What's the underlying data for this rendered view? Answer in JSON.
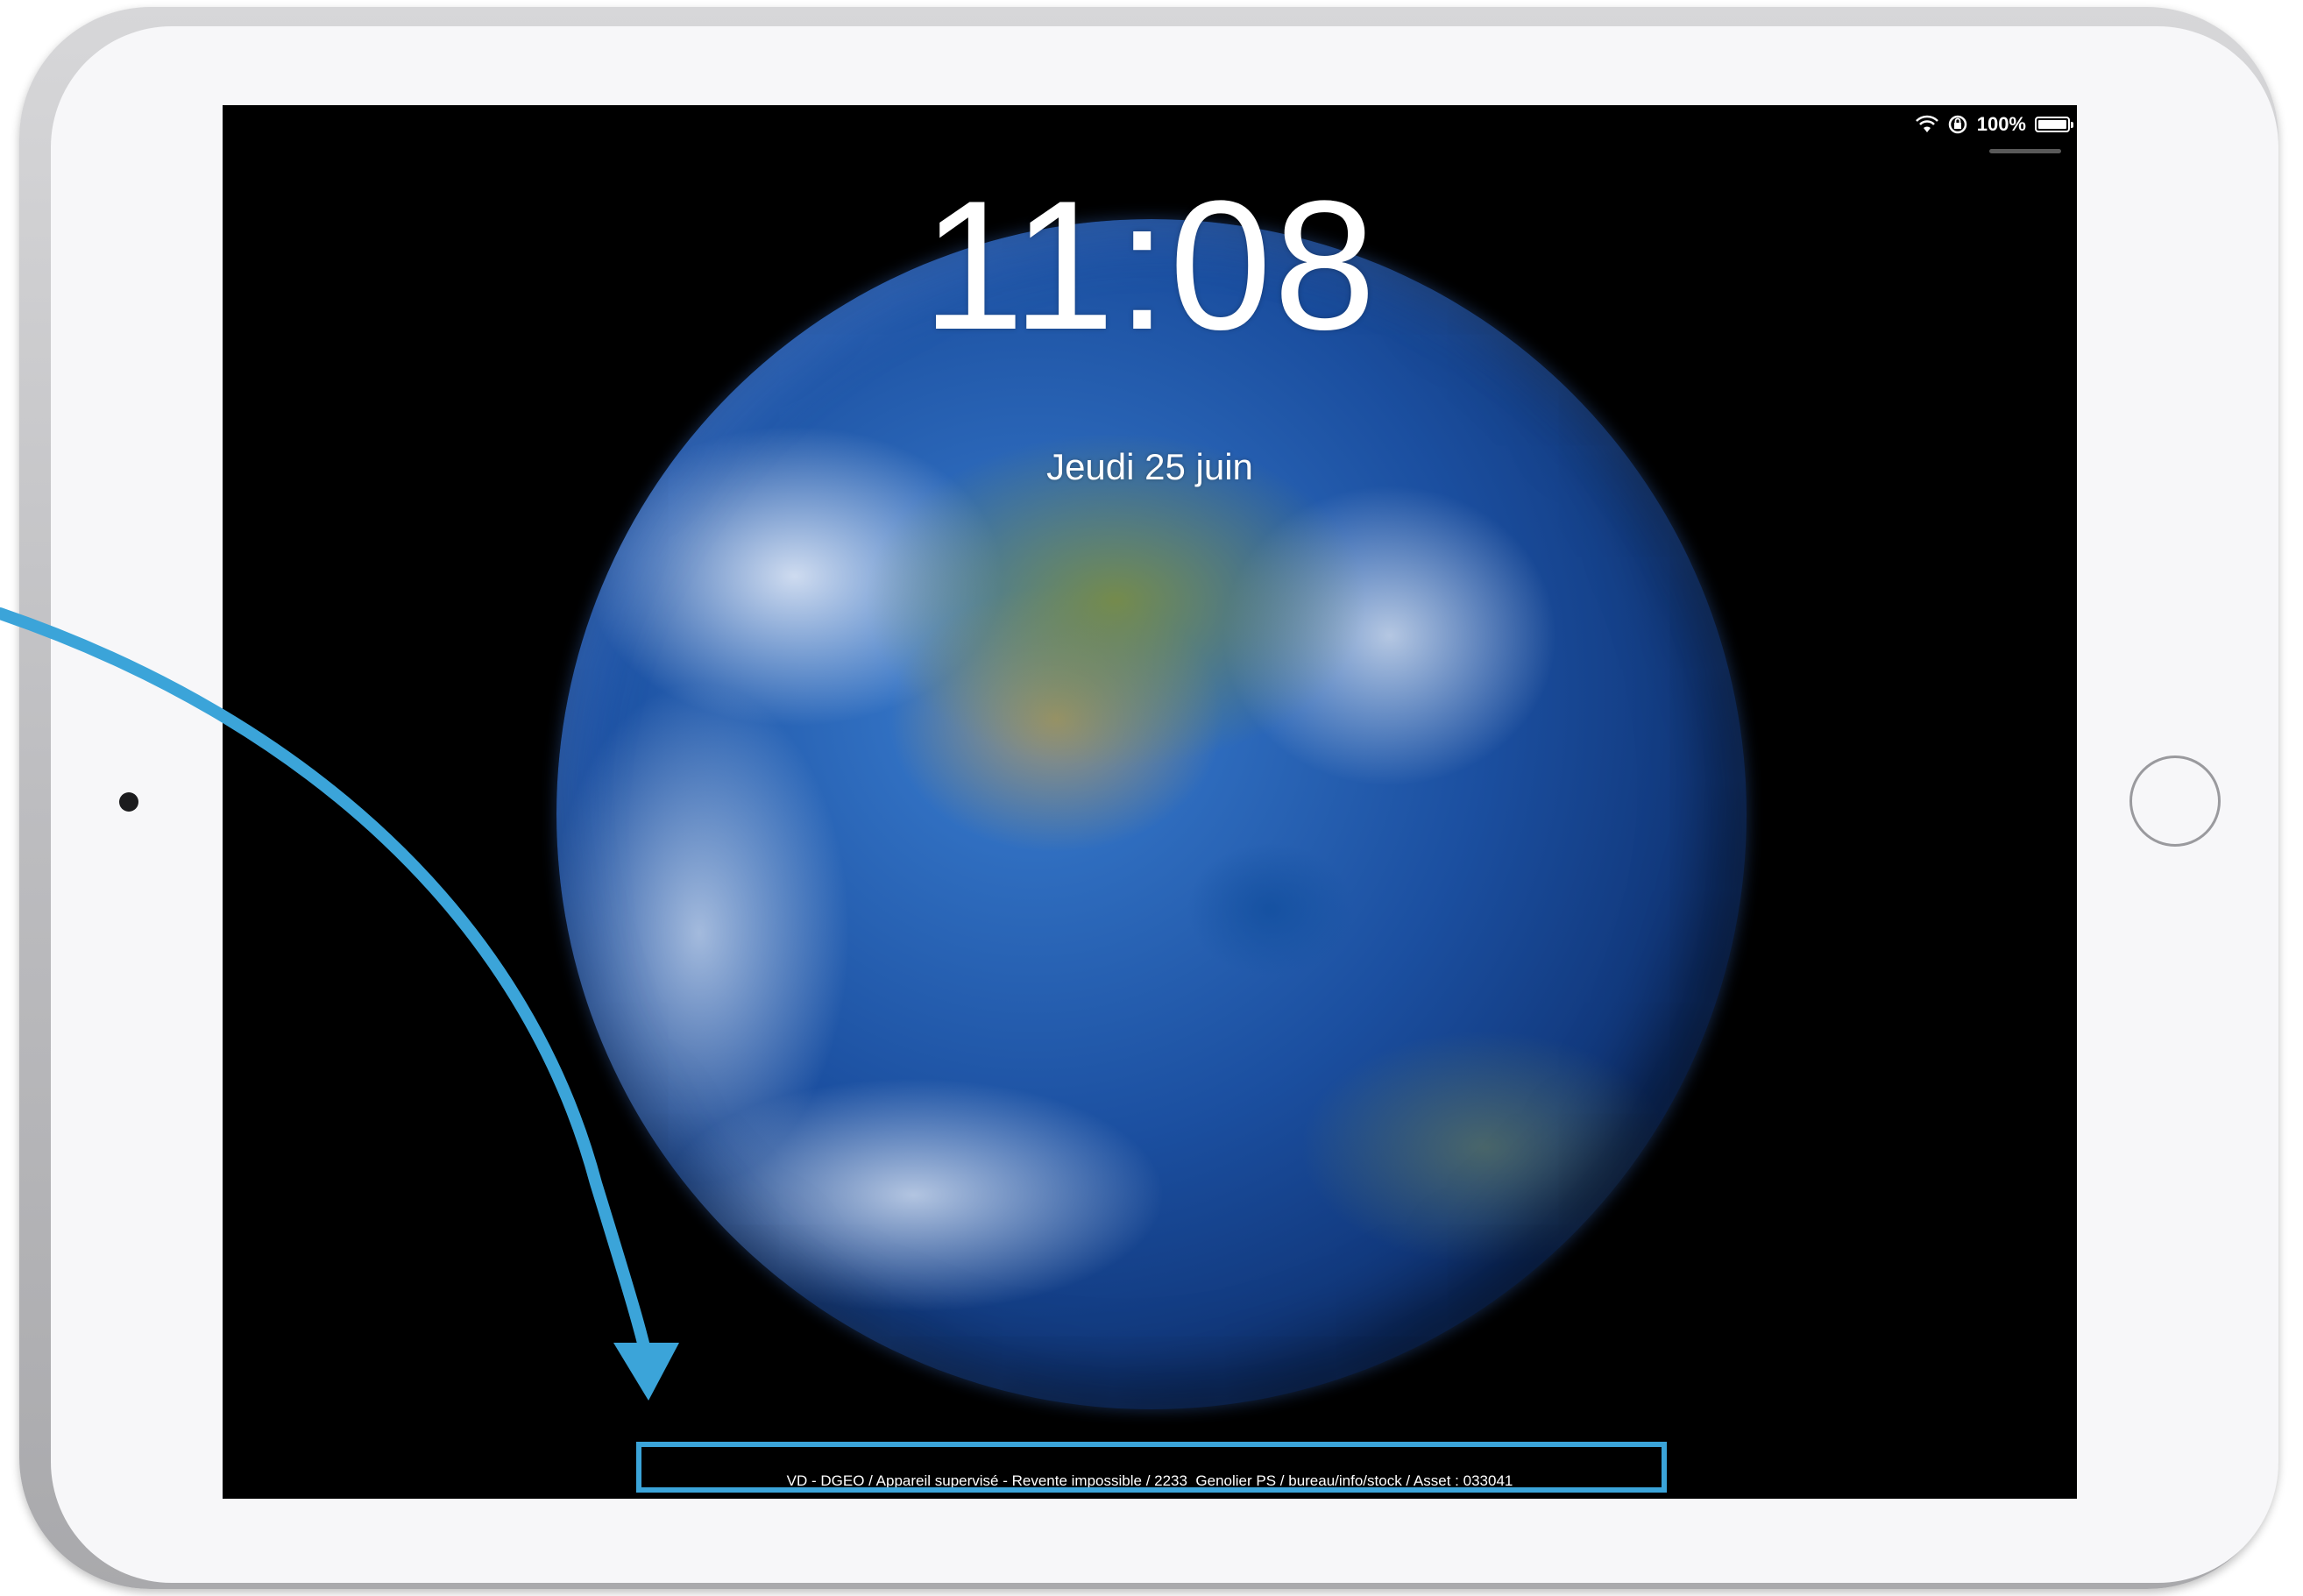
{
  "status_bar": {
    "battery_text": "100%",
    "battery_level": 1.0
  },
  "lock_screen": {
    "time": "11:08",
    "date": "Jeudi 25 juin",
    "footnote": "VD - DGEO / Appareil supervisé - Revente impossible / 2233_Genolier PS / bureau/info/stock / Asset : 033041"
  },
  "annotation": {
    "color": "#3ba4d9"
  },
  "device": {
    "wallpaper": "earth-wallpaper"
  }
}
